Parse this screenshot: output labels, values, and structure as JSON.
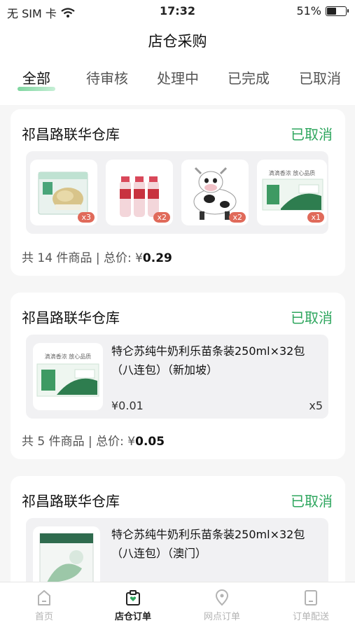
{
  "status_bar": {
    "carrier": "无 SIM 卡",
    "time": "17:32",
    "battery": "51%",
    "battery_level": 0.51
  },
  "header": {
    "title": "店仓采购"
  },
  "tabs": [
    {
      "label": "全部",
      "active": true
    },
    {
      "label": "待审核",
      "active": false
    },
    {
      "label": "处理中",
      "active": false
    },
    {
      "label": "已完成",
      "active": false
    },
    {
      "label": "已取消",
      "active": false
    }
  ],
  "orders": [
    {
      "warehouse": "祁昌路联华仓库",
      "status": "已取消",
      "items": [
        {
          "qty_badge": "x3",
          "icon": "gift-box-product"
        },
        {
          "qty_badge": "x2",
          "icon": "milk-bottles-product"
        },
        {
          "qty_badge": "x2",
          "icon": "cow-toy-product"
        },
        {
          "qty_badge": "x1",
          "icon": "milk-carton-product",
          "caption": "滴滴香浓 放心品质"
        }
      ],
      "summary_prefix": "共 14 件商品 | 总价: ¥",
      "total": "0.29"
    },
    {
      "warehouse": "祁昌路联华仓库",
      "status": "已取消",
      "product_name": "特仑苏纯牛奶利乐苗条装250ml×32包（八连包）（新加坡）",
      "product_caption": "滴滴香浓 放心品质",
      "price": "¥0.01",
      "qty": "x5",
      "summary_prefix": "共 5 件商品 | 总价: ¥",
      "total": "0.05"
    },
    {
      "warehouse": "祁昌路联华仓库",
      "status": "已取消",
      "product_name": "特仑苏纯牛奶利乐苗条装250ml×32包（八连包）（澳门）"
    }
  ],
  "bottom_nav": [
    {
      "label": "首页",
      "icon": "home-icon",
      "active": false
    },
    {
      "label": "店仓订单",
      "icon": "store-order-icon",
      "active": true
    },
    {
      "label": "网点订单",
      "icon": "location-pin-icon",
      "active": false
    },
    {
      "label": "订单配送",
      "icon": "delivery-icon",
      "active": false
    }
  ],
  "colors": {
    "accent": "#2ea65e",
    "badge": "#e06a5a"
  }
}
